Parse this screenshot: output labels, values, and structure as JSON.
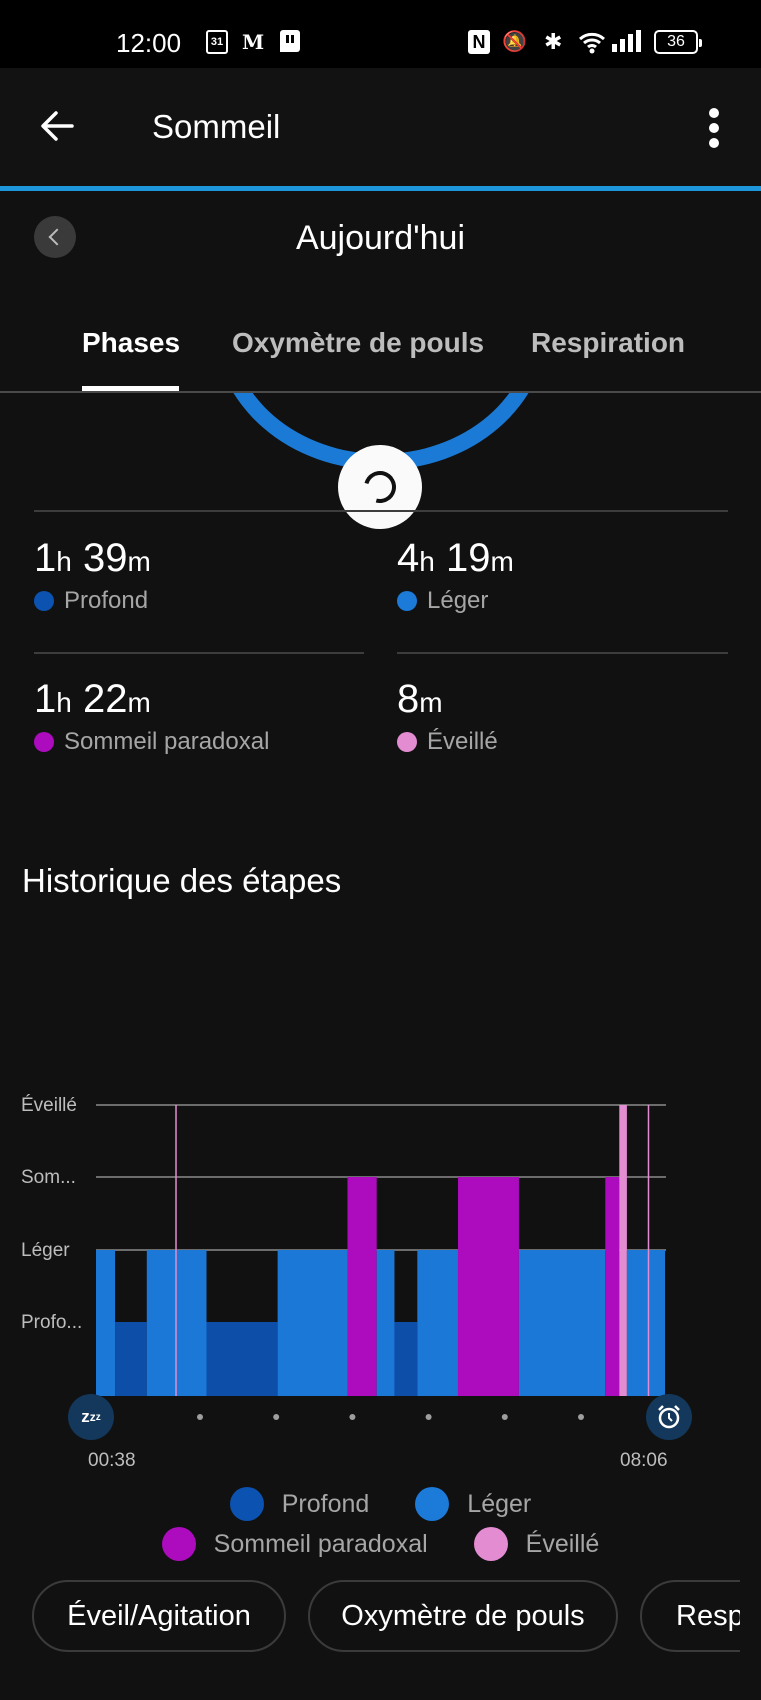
{
  "status_bar": {
    "time": "12:00",
    "calendar_badge": "31",
    "battery": "36",
    "icons": [
      "calendar-icon",
      "le-monde-icon",
      "twitch-icon",
      "nfc-icon",
      "mute-icon",
      "bluetooth-icon",
      "wifi-icon",
      "signal-icon",
      "battery-icon"
    ]
  },
  "app_bar": {
    "title": "Sommeil",
    "back_icon": "arrow-left-icon",
    "menu_icon": "more-vertical-icon"
  },
  "date_nav": {
    "title": "Aujourd'hui",
    "prev_icon": "chevron-left-icon"
  },
  "tabs": [
    {
      "label": "Phases",
      "active": true
    },
    {
      "label": "Oxymètre de pouls",
      "active": false
    },
    {
      "label": "Respiration",
      "active": false
    }
  ],
  "stats": [
    {
      "hours": "1",
      "minutes": "39",
      "h_unit": "h",
      "m_unit": "m",
      "label": "Profond",
      "color": "#0c52b0"
    },
    {
      "hours": "4",
      "minutes": "19",
      "h_unit": "h",
      "m_unit": "m",
      "label": "Léger",
      "color": "#1c7ad8"
    },
    {
      "hours": "1",
      "minutes": "22",
      "h_unit": "h",
      "m_unit": "m",
      "label": "Sommeil paradoxal",
      "color": "#ac0cbe"
    },
    {
      "hours": "",
      "minutes": "8",
      "h_unit": "",
      "m_unit": "m",
      "label": "Éveillé",
      "color": "#e38cd2"
    }
  ],
  "section_title": "Historique des étapes",
  "chart_data": {
    "type": "step-bar",
    "title": "Historique des étapes",
    "y_levels": [
      "Profo...",
      "Léger",
      "Som...",
      "Éveillé"
    ],
    "y_levels_full": [
      "Profond",
      "Léger",
      "Sommeil paradoxal",
      "Éveillé"
    ],
    "x_start_label": "00:38",
    "x_end_label": "08:06",
    "x_range_minutes": [
      0,
      448
    ],
    "start_icon": "sleep-zzz-icon",
    "end_icon": "alarm-clock-icon",
    "tick_dots": 6,
    "colors": {
      "Profond": "#0c4ea8",
      "Léger": "#1c78d6",
      "Sommeil paradoxal": "#ac0cbe",
      "Éveillé": "#e38cd2"
    },
    "segments": [
      {
        "stage": "Léger",
        "start": 0,
        "end": 15
      },
      {
        "stage": "Profond",
        "start": 15,
        "end": 40
      },
      {
        "stage": "Léger",
        "start": 40,
        "end": 87
      },
      {
        "stage": "Profond",
        "start": 87,
        "end": 143
      },
      {
        "stage": "Léger",
        "start": 143,
        "end": 198
      },
      {
        "stage": "Sommeil paradoxal",
        "start": 198,
        "end": 221
      },
      {
        "stage": "Léger",
        "start": 221,
        "end": 235
      },
      {
        "stage": "Profond",
        "start": 235,
        "end": 253
      },
      {
        "stage": "Léger",
        "start": 253,
        "end": 285
      },
      {
        "stage": "Sommeil paradoxal",
        "start": 285,
        "end": 333
      },
      {
        "stage": "Léger",
        "start": 333,
        "end": 401
      },
      {
        "stage": "Sommeil paradoxal",
        "start": 401,
        "end": 412
      },
      {
        "stage": "Éveillé",
        "start": 412,
        "end": 418
      },
      {
        "stage": "Léger",
        "start": 418,
        "end": 448
      }
    ],
    "awake_markers": [
      63,
      435
    ],
    "legend": [
      {
        "label": "Profond",
        "color": "#0c52b0"
      },
      {
        "label": "Léger",
        "color": "#1c7ad8"
      },
      {
        "label": "Sommeil paradoxal",
        "color": "#ac0cbe"
      },
      {
        "label": "Éveillé",
        "color": "#e38cd2"
      }
    ]
  },
  "chips": [
    {
      "label": "Éveil/Agitation"
    },
    {
      "label": "Oxymètre de pouls"
    },
    {
      "label": "Resp"
    }
  ]
}
